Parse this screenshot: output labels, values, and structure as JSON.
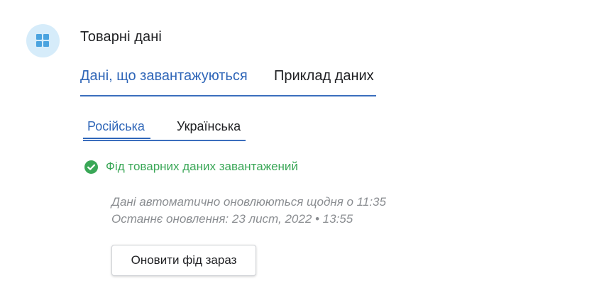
{
  "header": {
    "icon": "grid-icon",
    "title": "Товарні дані"
  },
  "main_tabs": [
    {
      "label": "Дані, що завантажуються",
      "active": true
    },
    {
      "label": "Приклад даних",
      "active": false
    }
  ],
  "language_tabs": [
    {
      "label": "Російська",
      "active": true
    },
    {
      "label": "Українська",
      "active": false
    }
  ],
  "status": {
    "icon": "check-circle-icon",
    "text": "Фід товарних даних завантажений"
  },
  "info": {
    "schedule": "Дані автоматично оновлюються щодня о 11:35",
    "last_update": "Останнє оновлення: 23 лист, 2022 • 13:55"
  },
  "actions": {
    "refresh_label": "Оновити фід зараз"
  },
  "colors": {
    "accent": "#2f66b8",
    "success": "#3aa757",
    "icon_bg": "#d6ecfa",
    "icon_fg": "#4aa3df",
    "muted_text": "#8a8d91"
  }
}
